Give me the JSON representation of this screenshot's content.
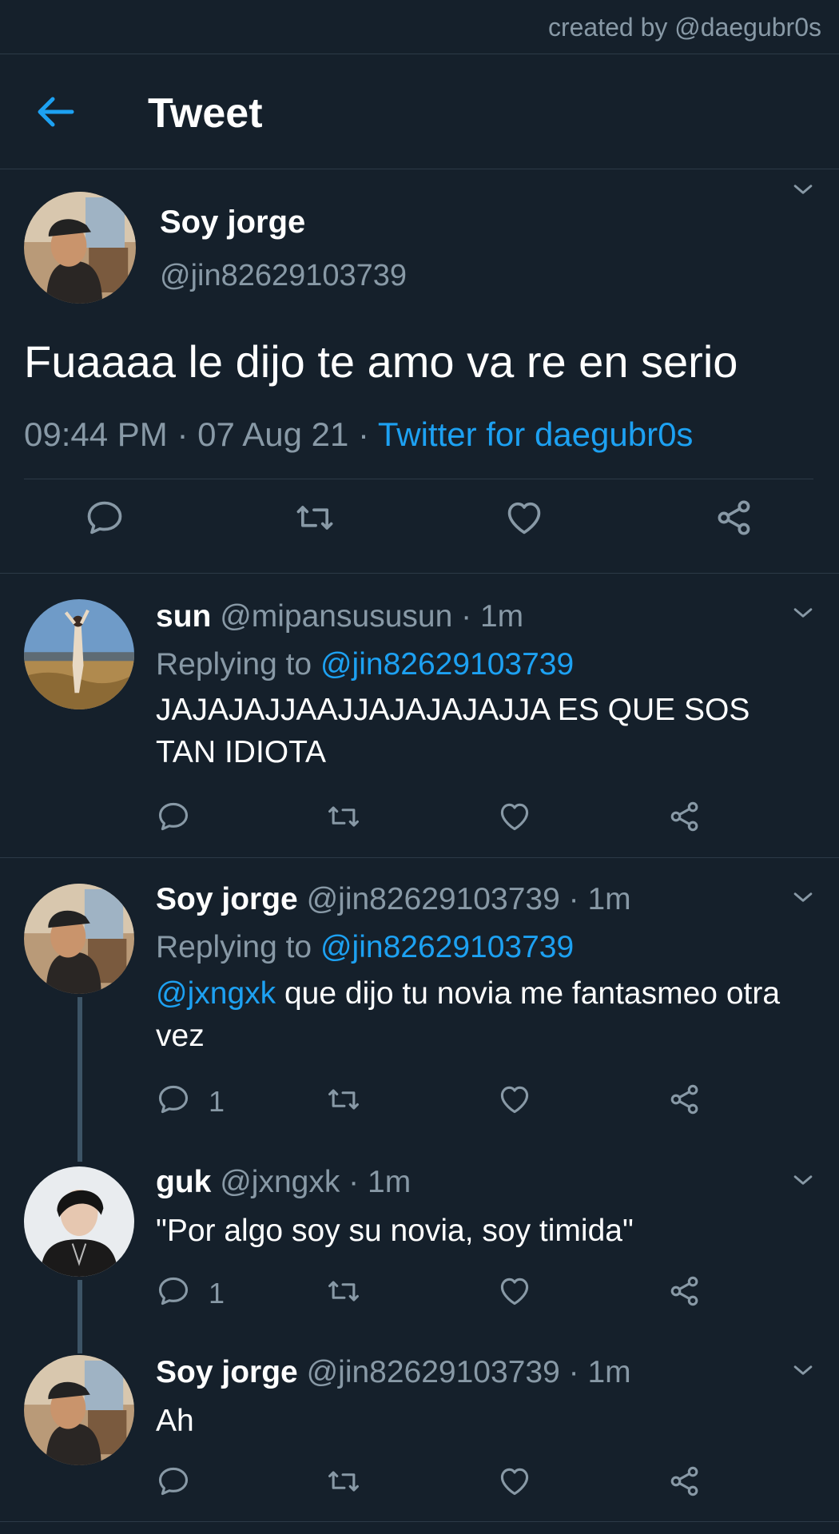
{
  "credit": "created by @daegubr0s",
  "header": {
    "title": "Tweet",
    "back_icon": "arrow-left-icon"
  },
  "colors": {
    "background": "#15202b",
    "accent": "#1da1f2",
    "secondary_text": "#8899a6",
    "divider": "#2c3a47"
  },
  "main_tweet": {
    "name": "Soy jorge",
    "handle": "@jin82629103739",
    "text": "Fuaaaa le dijo te amo va re en serio",
    "time": "09:44 PM",
    "date": "07 Aug 21",
    "sep": "·",
    "source": "Twitter for daegubr0s"
  },
  "replies": [
    {
      "name": "sun",
      "handle": "@mipansususun",
      "time": "1m",
      "sep": "·",
      "replying_label": "Replying to",
      "replying_to": "@jin82629103739",
      "text": "JAJAJAJJAAJJAJAJAJAJJA ES QUE SOS TAN IDIOTA",
      "reply_count": ""
    },
    {
      "name": "Soy jorge",
      "handle": "@jin82629103739",
      "time": "1m",
      "sep": "·",
      "replying_label": "Replying to",
      "replying_to": "@jin82629103739",
      "mention": "@jxngxk",
      "text": " que dijo tu novia me fantasmeo otra vez",
      "reply_count": "1"
    },
    {
      "name": "guk",
      "handle": "@jxngxk",
      "time": "1m",
      "sep": "·",
      "text": "\"Por algo soy su novia, soy timida\"",
      "reply_count": "1"
    },
    {
      "name": "Soy jorge",
      "handle": "@jin82629103739",
      "time": "1m",
      "sep": "·",
      "text": "Ah",
      "reply_count": ""
    }
  ]
}
